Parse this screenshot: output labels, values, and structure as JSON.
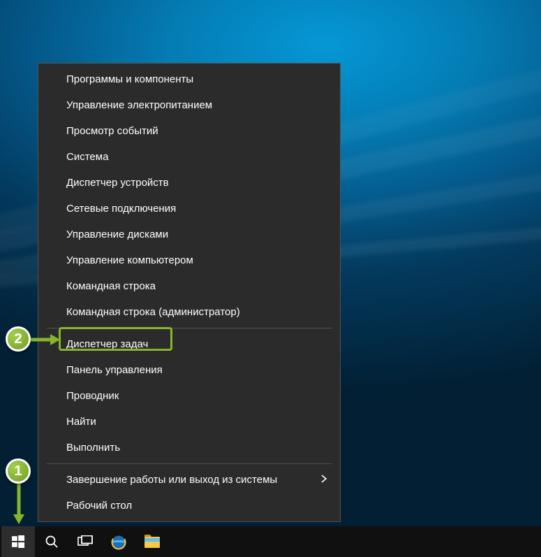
{
  "menu": {
    "items": [
      {
        "label": "Программы и компоненты",
        "name": "menu-programs-and-features"
      },
      {
        "label": "Управление электропитанием",
        "name": "menu-power-options"
      },
      {
        "label": "Просмотр событий",
        "name": "menu-event-viewer"
      },
      {
        "label": "Система",
        "name": "menu-system"
      },
      {
        "label": "Диспетчер устройств",
        "name": "menu-device-manager"
      },
      {
        "label": "Сетевые подключения",
        "name": "menu-network-connections"
      },
      {
        "label": "Управление дисками",
        "name": "menu-disk-management"
      },
      {
        "label": "Управление компьютером",
        "name": "menu-computer-management"
      },
      {
        "label": "Командная строка",
        "name": "menu-command-prompt"
      },
      {
        "label": "Командная строка (администратор)",
        "name": "menu-command-prompt-admin"
      },
      {
        "separator": true
      },
      {
        "label": "Диспетчер задач",
        "name": "menu-task-manager"
      },
      {
        "label": "Панель управления",
        "name": "menu-control-panel",
        "highlight": true
      },
      {
        "label": "Проводник",
        "name": "menu-file-explorer"
      },
      {
        "label": "Найти",
        "name": "menu-search"
      },
      {
        "label": "Выполнить",
        "name": "menu-run"
      },
      {
        "separator": true
      },
      {
        "label": "Завершение работы или выход из системы",
        "name": "menu-shutdown",
        "submenu": true
      },
      {
        "label": "Рабочий стол",
        "name": "menu-desktop"
      }
    ]
  },
  "annotations": {
    "badge1": "1",
    "badge2": "2"
  },
  "colors": {
    "highlight": "#86b52b",
    "menu_bg": "#2b2b2b"
  }
}
